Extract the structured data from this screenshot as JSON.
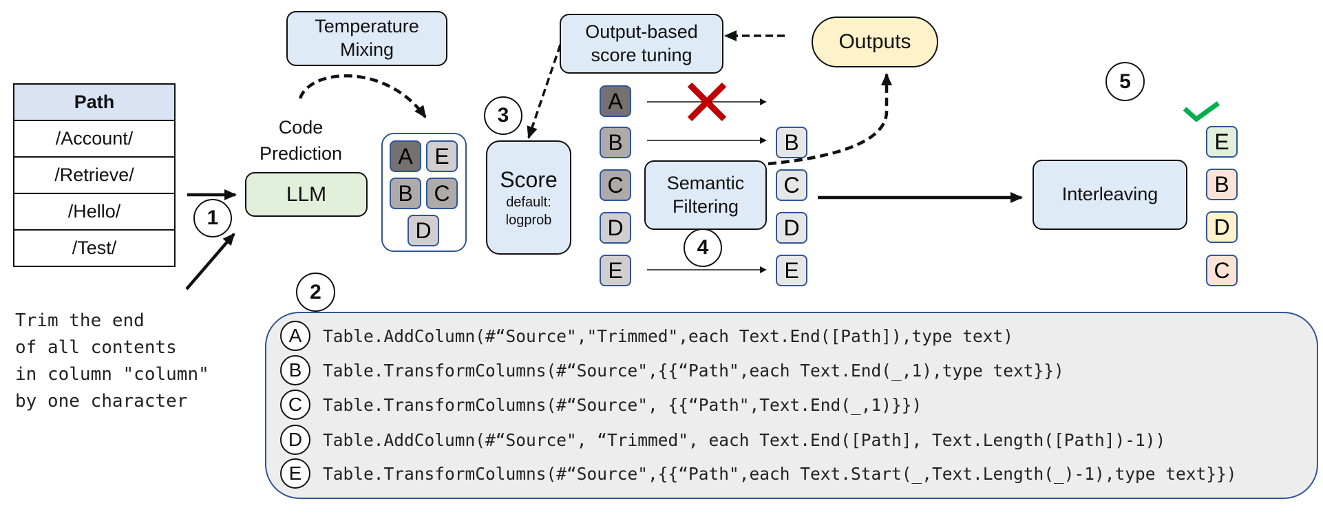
{
  "input_table": {
    "header": "Path",
    "rows": [
      "/Account/",
      "/Retrieve/",
      "/Hello/",
      "/Test/"
    ]
  },
  "instruction": "Trim the end\nof all contents\nin column \"column\"\nby one character",
  "steps": {
    "step1": "1",
    "step2": "2",
    "step3": "3",
    "step4": "4",
    "step5": "5"
  },
  "nodes": {
    "temperature_mixing": "Temperature\nMixing",
    "code_prediction": "Code\nPrediction",
    "llm": "LLM",
    "score_title": "Score",
    "score_subtitle": "default:\nlogprob",
    "output_tuning": "Output-based\nscore tuning",
    "outputs": "Outputs",
    "semantic_filtering": "Semantic\nFiltering",
    "interleaving": "Interleaving"
  },
  "candidate_pool": [
    {
      "id": "A",
      "shade": "dark"
    },
    {
      "id": "E",
      "shade": "light"
    },
    {
      "id": "B",
      "shade": "mid"
    },
    {
      "id": "C",
      "shade": "mid"
    },
    {
      "id": "D",
      "shade": "light"
    }
  ],
  "scored_candidates": [
    {
      "id": "A",
      "shade": "dark",
      "filtered_out": true
    },
    {
      "id": "B",
      "shade": "mid",
      "filtered_out": false
    },
    {
      "id": "C",
      "shade": "mid",
      "filtered_out": false
    },
    {
      "id": "D",
      "shade": "light",
      "filtered_out": false
    },
    {
      "id": "E",
      "shade": "light",
      "filtered_out": false
    }
  ],
  "filtered_candidates": [
    "B",
    "C",
    "D",
    "E"
  ],
  "final_ranking": [
    {
      "id": "E",
      "color": "#e2efda",
      "correct": true
    },
    {
      "id": "B",
      "color": "#fbe4d5",
      "correct": false
    },
    {
      "id": "D",
      "color": "#fef2cb",
      "correct": false
    },
    {
      "id": "C",
      "color": "#fbe4d5",
      "correct": false
    }
  ],
  "code_options": [
    {
      "label": "A",
      "code": "Table.AddColumn(#“Source\",\"Trimmed\",each Text.End([Path]),type text)"
    },
    {
      "label": "B",
      "code": "Table.TransformColumns(#“Source\",{{“Path\",each Text.End(_,1),type text}})"
    },
    {
      "label": "C",
      "code": "Table.TransformColumns(#“Source\", {{“Path\",Text.End(_,1)}})"
    },
    {
      "label": "D",
      "code": "Table.AddColumn(#“Source\", “Trimmed\", each Text.End([Path], Text.Length([Path])-1))"
    },
    {
      "label": "E",
      "code": "Table.TransformColumns(#“Source\",{{“Path\",each Text.Start(_,Text.Length(_)-1),type text}})"
    }
  ],
  "colors": {
    "node_blue": "#deeaf6",
    "llm_green": "#e2efda",
    "outputs_cream": "#fef2cb",
    "reject_red": "#c00000",
    "accept_green": "#00b050",
    "accent_border": "#2f5597"
  }
}
